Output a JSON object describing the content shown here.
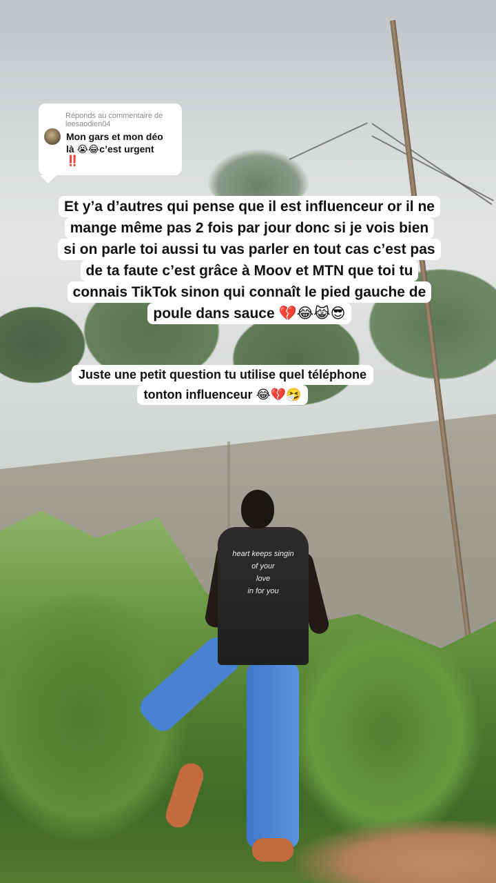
{
  "reply": {
    "header_line1": "Réponds au commentaire de",
    "header_line2": "leesaodien04",
    "comment_line1": "Mon gars et mon déo",
    "comment_line2": "là 😭😂c’est urgent",
    "comment_mark": "‼️"
  },
  "captions": [
    {
      "lines": [
        "Et y’a d’autres qui pense que il est influenceur or il ne",
        "mange même pas 2 fois par jour donc si je vois bien",
        "si on parle toi aussi tu vas parler en tout cas c’est pas",
        "de ta faute c’est grâce à Moov et MTN que toi tu",
        "connais TikTok sinon qui connaît le pied gauche de",
        "poule dans sauce 💔😂😹😎"
      ]
    },
    {
      "lines": [
        "Juste une petit question tu utilise quel téléphone",
        "tonton influenceur 😂💔🤧"
      ]
    }
  ],
  "scene": {
    "shirt_text": [
      "heart keeps singin",
      "of your",
      "love",
      "in for you"
    ]
  },
  "colors": {
    "caption_bg": "#ffffff",
    "caption_text": "#111111",
    "reply_header": "#8a8a8a",
    "accent_red": "#e0202a"
  }
}
